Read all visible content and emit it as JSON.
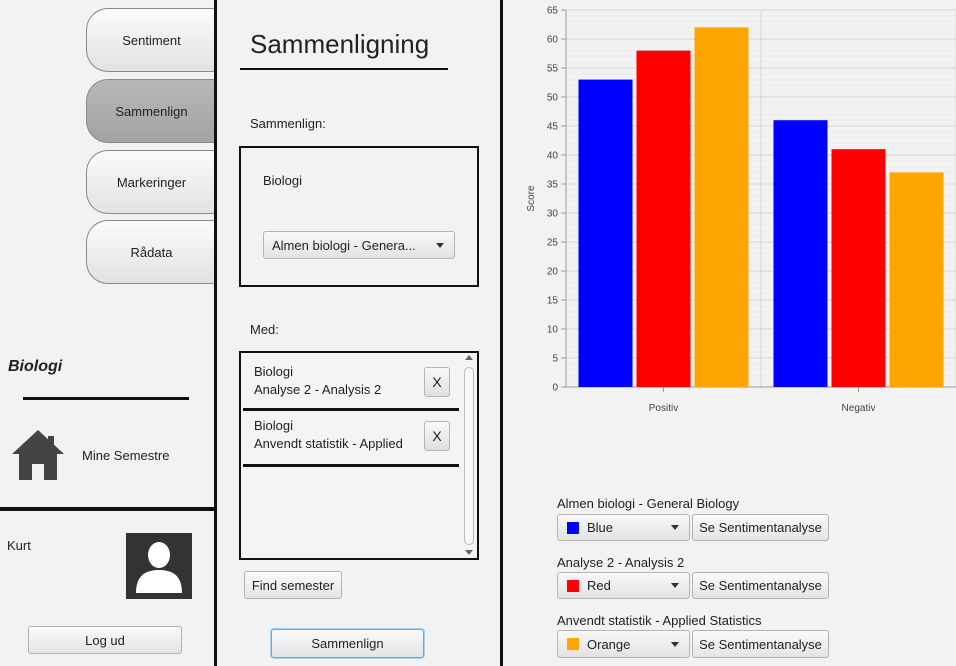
{
  "nav": {
    "tabs": [
      {
        "label": "Sentiment"
      },
      {
        "label": "Sammenlign"
      },
      {
        "label": "Markeringer"
      },
      {
        "label": "Rådata"
      }
    ]
  },
  "sidebar": {
    "section_title": "Biologi",
    "home_label": "Mine Semestre",
    "user_name": "Kurt",
    "logout_label": "Log ud"
  },
  "compare": {
    "title": "Sammenligning",
    "compare_label": "Sammenlign:",
    "base_box_label": "Biologi",
    "base_select": "Almen biologi - Genera...",
    "with_label": "Med:",
    "with_items": [
      {
        "line1": "Biologi",
        "line2": "Analyse 2 - Analysis 2",
        "remove": "X"
      },
      {
        "line1": "Biologi",
        "line2": "Anvendt statistik - Applied",
        "remove": "X"
      }
    ],
    "find_button": "Find semester",
    "compare_button": "Sammenlign"
  },
  "chart_data": {
    "type": "bar",
    "categories": [
      "Positiv",
      "Negativ"
    ],
    "series": [
      {
        "name": "Almen biologi - General Biology",
        "color": "#0000ff",
        "values": [
          53,
          46
        ]
      },
      {
        "name": "Analyse 2 - Analysis 2",
        "color": "#ff0000",
        "values": [
          58,
          41
        ]
      },
      {
        "name": "Anvendt statistik - Applied Statistics",
        "color": "#ffa500",
        "values": [
          62,
          37
        ]
      }
    ],
    "ylabel": "Score",
    "ylim": [
      0,
      65
    ],
    "yticks": [
      0,
      5,
      10,
      15,
      20,
      25,
      30,
      35,
      40,
      45,
      50,
      55,
      60,
      65
    ],
    "grid": true
  },
  "legend": {
    "rows": [
      {
        "title": "Almen biologi - General Biology",
        "color_name": "Blue",
        "color": "#0000ff",
        "button": "Se Sentimentanalyse"
      },
      {
        "title": "Analyse 2 - Analysis 2",
        "color_name": "Red",
        "color": "#ff0000",
        "button": "Se Sentimentanalyse"
      },
      {
        "title": "Anvendt statistik - Applied Statistics",
        "color_name": "Orange",
        "color": "#ffa500",
        "button": "Se Sentimentanalyse"
      }
    ]
  }
}
